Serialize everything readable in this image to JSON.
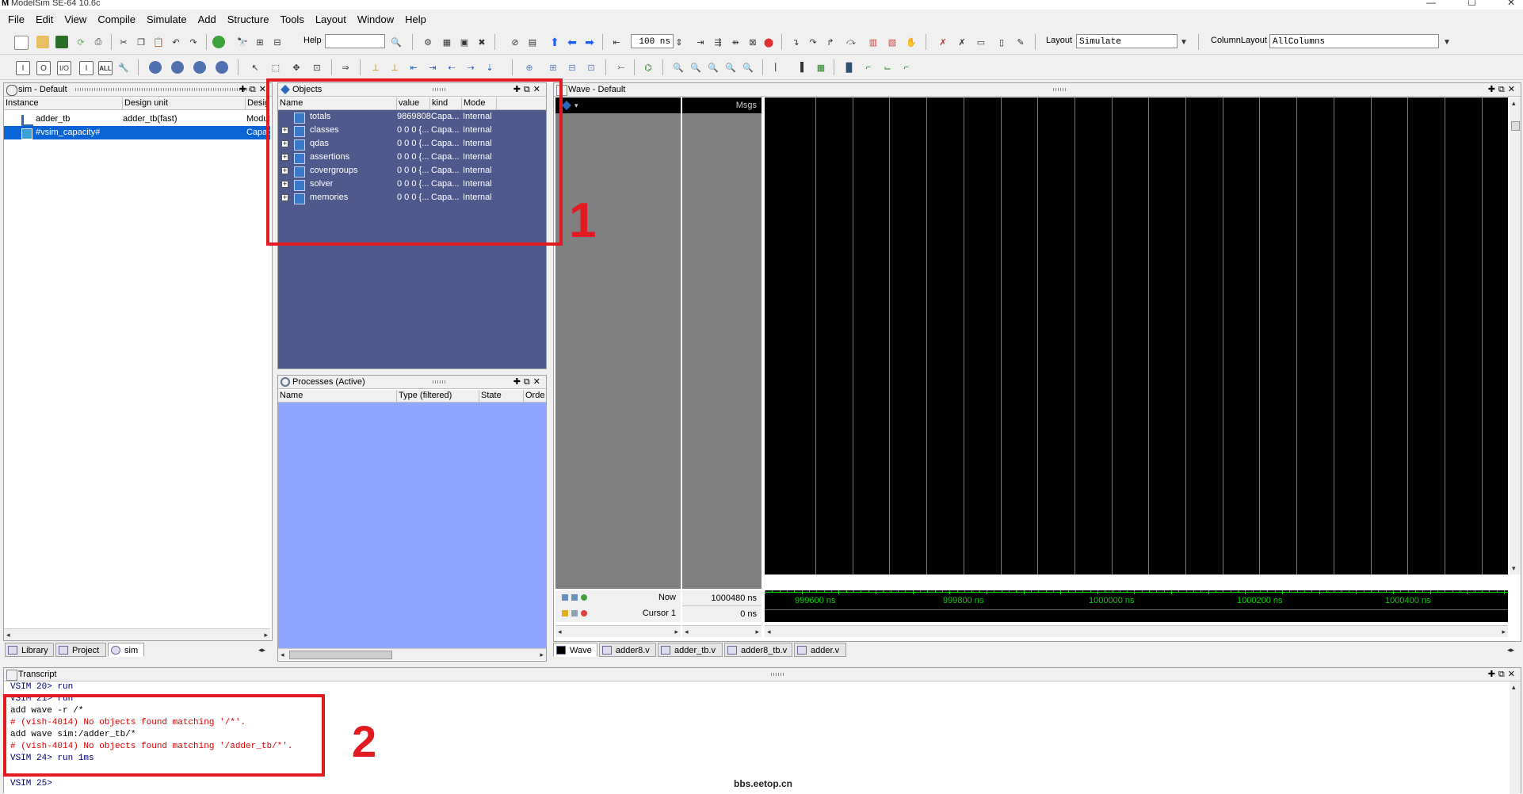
{
  "window": {
    "title": "ModelSim SE-64 10.6c",
    "logo_letter": "M",
    "min": "—",
    "max": "☐",
    "close": "✕"
  },
  "menu": [
    "File",
    "Edit",
    "View",
    "Compile",
    "Simulate",
    "Add",
    "Structure",
    "Tools",
    "Layout",
    "Window",
    "Help"
  ],
  "toolbar": {
    "help_label": "Help",
    "help_value": "",
    "run_length": "100 ns",
    "layout_label": "Layout",
    "layout_value": "Simulate",
    "column_layout_label": "ColumnLayout",
    "column_layout_value": "AllColumns",
    "filter_buttons": [
      "I",
      "O",
      "I/O",
      "I",
      "ALL"
    ]
  },
  "sim_pane": {
    "title": "sim - Default",
    "columns": [
      "Instance",
      "Design unit",
      "Desig"
    ],
    "rows": [
      {
        "instance": "adder_tb",
        "design_unit": "adder_tb(fast)",
        "type": "Modul",
        "selected": false
      },
      {
        "instance": "#vsim_capacity#",
        "design_unit": "",
        "type": "Capac",
        "selected": true
      }
    ],
    "tabs": [
      "Library",
      "Project",
      "sim"
    ]
  },
  "objects_pane": {
    "title": "Objects",
    "columns": [
      "Name",
      "value",
      "kind",
      "Mode"
    ],
    "rows": [
      {
        "name": "totals",
        "value": "9869808",
        "kind": "Capa...",
        "mode": "Internal",
        "expandable": false
      },
      {
        "name": "classes",
        "value": "0 0 0 {...",
        "kind": "Capa...",
        "mode": "Internal",
        "expandable": true
      },
      {
        "name": "qdas",
        "value": "0 0 0 {...",
        "kind": "Capa...",
        "mode": "Internal",
        "expandable": true
      },
      {
        "name": "assertions",
        "value": "0 0 0 {...",
        "kind": "Capa...",
        "mode": "Internal",
        "expandable": true
      },
      {
        "name": "covergroups",
        "value": "0 0 0 {...",
        "kind": "Capa...",
        "mode": "Internal",
        "expandable": true
      },
      {
        "name": "solver",
        "value": "0 0 0 {...",
        "kind": "Capa...",
        "mode": "Internal",
        "expandable": true
      },
      {
        "name": "memories",
        "value": "0 0 0 {...",
        "kind": "Capa...",
        "mode": "Internal",
        "expandable": true
      }
    ]
  },
  "processes_pane": {
    "title": "Processes (Active)",
    "columns": [
      "Name",
      "Type (filtered)",
      "State",
      "Orde"
    ]
  },
  "wave_pane": {
    "title": "Wave - Default",
    "msgs_label": "Msgs",
    "now_label": "Now",
    "now_value": "1000480 ns",
    "cursor_label": "Cursor 1",
    "cursor_value": "0 ns",
    "ticks": [
      "999600 ns",
      "999800 ns",
      "1000000 ns",
      "1000200 ns",
      "1000400 ns"
    ],
    "tabs": [
      "Wave",
      "adder8.v",
      "adder_tb.v",
      "adder8_tb.v",
      "adder.v"
    ]
  },
  "transcript": {
    "title": "Transcript",
    "lines": [
      {
        "text": "VSIM 20> run",
        "style": "blue"
      },
      {
        "text": "VSIM 21> run",
        "style": "blue"
      },
      {
        "text": "add wave -r /*",
        "style": "black"
      },
      {
        "text": "# (vish-4014) No objects found matching '/*'.",
        "style": "red"
      },
      {
        "text": "add wave sim:/adder_tb/*",
        "style": "black"
      },
      {
        "text": "# (vish-4014) No objects found matching '/adder_tb/*'.",
        "style": "red"
      },
      {
        "text": "VSIM 24> run 1ms",
        "style": "blue"
      },
      {
        "text": "VSIM 25>",
        "style": "blue"
      }
    ]
  },
  "annotations": {
    "box1_label": "1",
    "box2_label": "2",
    "watermark": "bbs.eetop.cn"
  },
  "colors": {
    "objects_bg": "#4f5a8c",
    "processes_bg": "#8fa5ff",
    "wave_bg": "#000000",
    "tick_green": "#00d000",
    "annot_red": "#e21b23",
    "selection_blue": "#0a64d6"
  }
}
